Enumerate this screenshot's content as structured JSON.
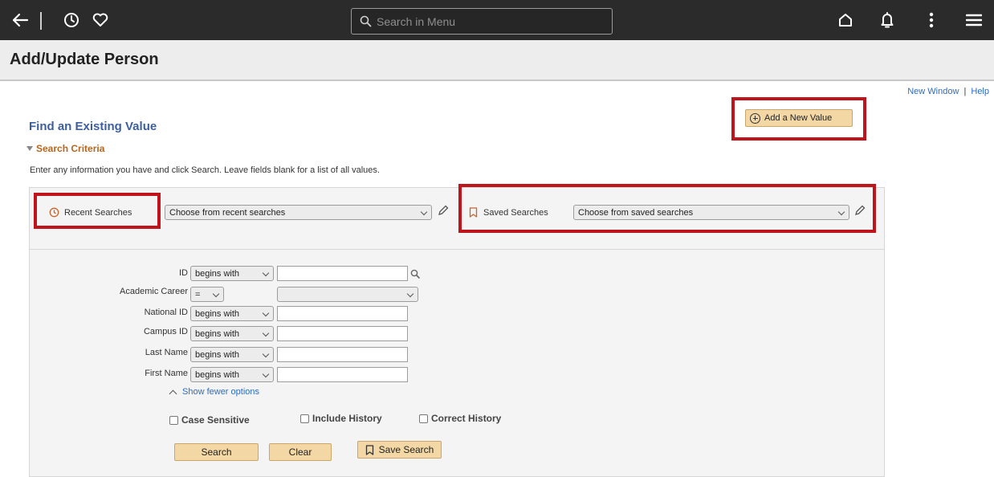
{
  "topbar": {
    "search_placeholder": "Search in Menu",
    "icons": [
      "back-arrow-icon",
      "history-clock-icon",
      "favorites-heart-icon",
      "home-icon",
      "notifications-bell-icon",
      "more-options-icon",
      "menu-icon"
    ]
  },
  "page": {
    "title": "Add/Update Person"
  },
  "links": {
    "new_window": "New Window",
    "separator": "|",
    "help": "Help"
  },
  "find": {
    "title": "Find an Existing Value",
    "add_new_label": "Add a New Value"
  },
  "criteria": {
    "title": "Search Criteria",
    "instructions": "Enter any information you have and click Search. Leave fields blank for a list of all values."
  },
  "recent": {
    "label": "Recent Searches",
    "select_value": "Choose from recent searches"
  },
  "saved": {
    "label": "Saved Searches",
    "select_value": "Choose from saved searches"
  },
  "fields": [
    {
      "label": "ID",
      "operator": "begins with",
      "value": ""
    },
    {
      "label": "Academic Career",
      "operator": "=",
      "value": ""
    },
    {
      "label": "National ID",
      "operator": "begins with",
      "value": ""
    },
    {
      "label": "Campus ID",
      "operator": "begins with",
      "value": ""
    },
    {
      "label": "Last Name",
      "operator": "begins with",
      "value": ""
    },
    {
      "label": "First Name",
      "operator": "begins with",
      "value": ""
    }
  ],
  "options": {
    "show_fewer": "Show fewer options",
    "case_sensitive": "Case Sensitive",
    "include_history": "Include History",
    "correct_history": "Correct History"
  },
  "buttons": {
    "search": "Search",
    "clear": "Clear",
    "save_search": "Save Search"
  },
  "colors": {
    "highlight_red": "#c0141c",
    "button_tan": "#f3d7a4",
    "topbar": "#2b2b2b",
    "link_blue": "#2a6cc7"
  }
}
